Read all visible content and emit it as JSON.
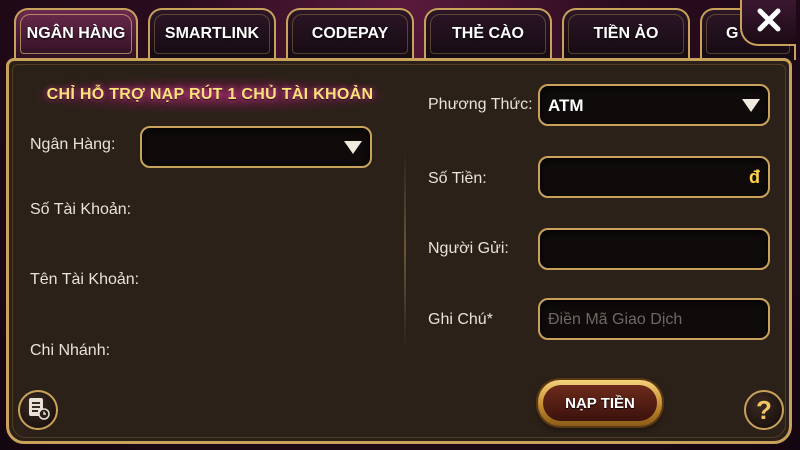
{
  "tabs": [
    {
      "label": "NGÂN HÀNG",
      "active": true
    },
    {
      "label": "SMARTLINK",
      "active": false
    },
    {
      "label": "CODEPAY",
      "active": false
    },
    {
      "label": "THẺ CÀO",
      "active": false
    },
    {
      "label": "TIỀN ẢO",
      "active": false
    },
    {
      "label": "G",
      "active": false
    }
  ],
  "close_icon": "close-icon",
  "notice": "CHỈ HỖ TRỢ NẠP RÚT 1 CHỦ TÀI KHOẢN",
  "left": {
    "bank_label": "Ngân Hàng:",
    "bank_value": "",
    "account_number_label": "Số Tài Khoản:",
    "account_name_label": "Tên Tài Khoản:",
    "branch_label": "Chi Nhánh:"
  },
  "right": {
    "method_label": "Phương Thức:",
    "method_value": "ATM",
    "amount_label": "Số Tiền:",
    "amount_value": "",
    "amount_suffix": "đ",
    "sender_label": "Người Gửi:",
    "sender_value": "",
    "note_label": "Ghi Chú*",
    "note_placeholder": "Điền Mã Giao Dịch"
  },
  "submit_label": "NẠP TIỀN",
  "icons": {
    "history": "history-icon",
    "help": "help-icon"
  },
  "colors": {
    "accent_gold": "#c8a25a",
    "notice_text": "#ffe27a",
    "panel_bg": "#2b2118",
    "currency": "#ffd24a"
  }
}
